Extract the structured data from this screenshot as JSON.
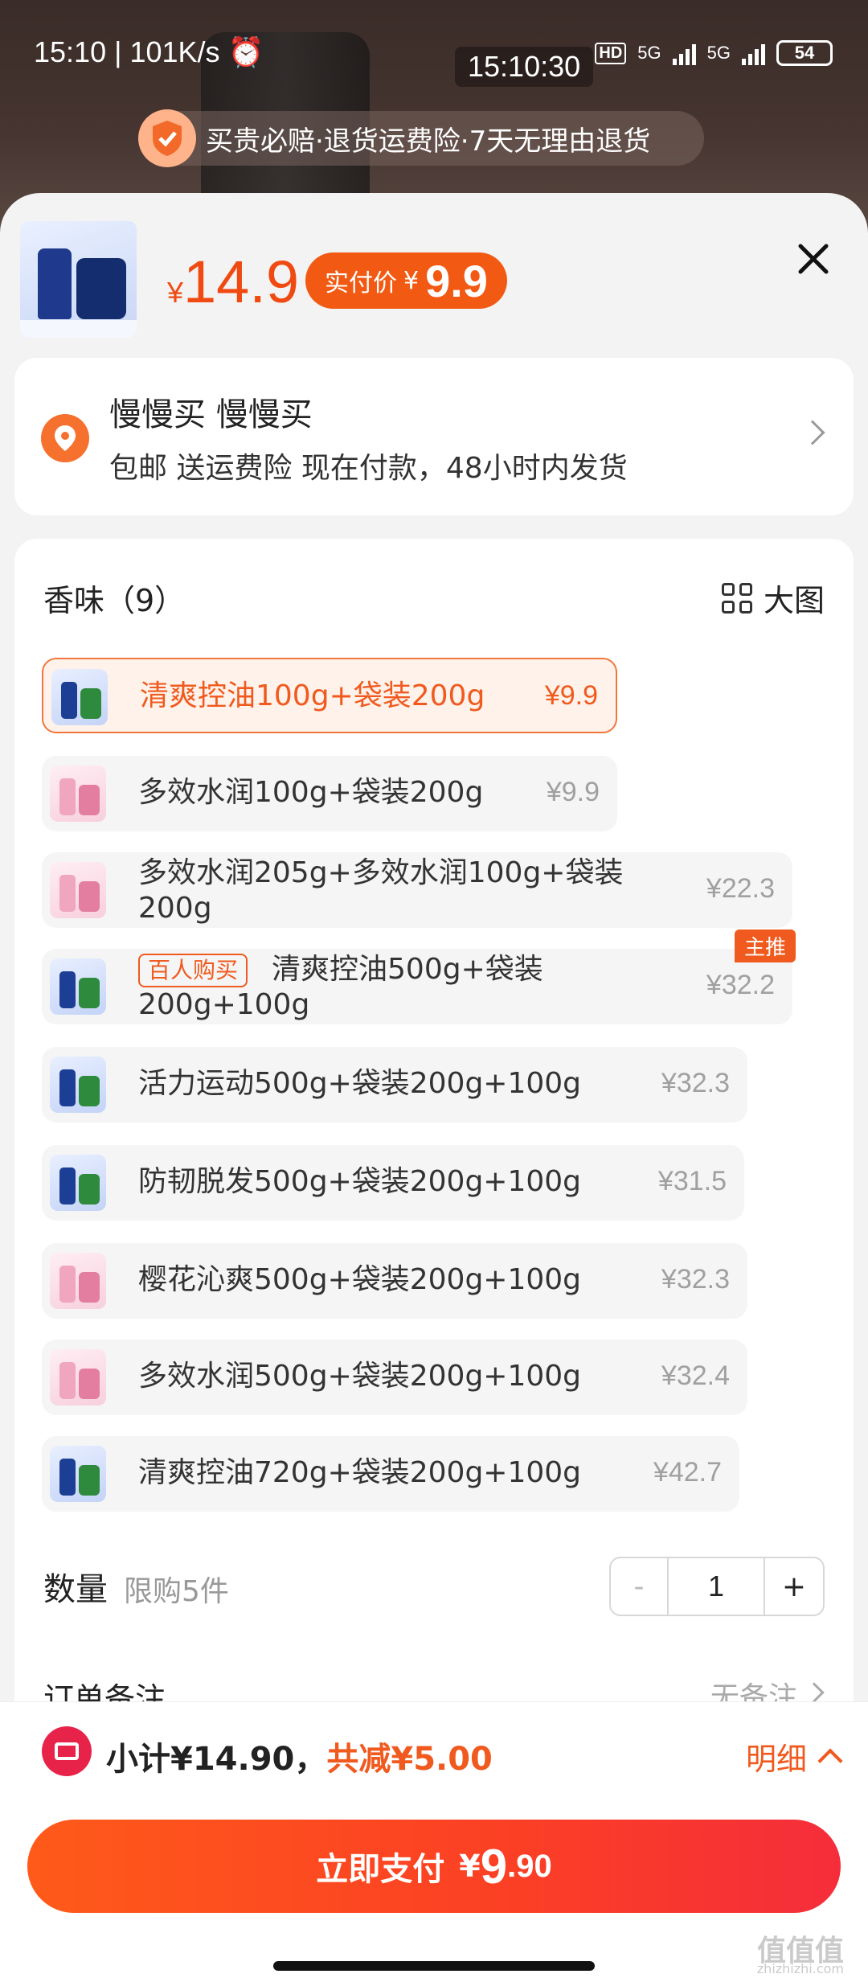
{
  "status_bar": {
    "time": "15:10",
    "speed": "101K/s",
    "center_time": "15:10:30",
    "network1": "5G",
    "network2": "5G",
    "battery": "54"
  },
  "guarantee_banner": "买贵必赔·退货运费险·7天无理由退货",
  "product_header": {
    "yen": "¥",
    "price": "14.9",
    "paid_label": "实付价",
    "paid_yen": "¥",
    "paid_price": "9.9"
  },
  "address": {
    "name": "慢慢买 慢慢买",
    "line": "包邮 送运费险 现在付款，48小时内发货"
  },
  "options": {
    "title": "香味（9）",
    "big_image": "大图",
    "items": [
      {
        "name": "清爽控油100g+袋装200g",
        "price": "¥9.9",
        "thumb": "blue",
        "selected": true
      },
      {
        "name": "多效水润100g+袋装200g",
        "price": "¥9.9",
        "thumb": "pink"
      },
      {
        "name": "多效水润205g+多效水润100g+袋装200g",
        "price": "¥22.3",
        "thumb": "pink"
      },
      {
        "name": "清爽控油500g+袋装200g+100g",
        "price": "¥32.2",
        "thumb": "blue",
        "tag": "百人购买",
        "badge": "主推"
      },
      {
        "name": "活力运动500g+袋装200g+100g",
        "price": "¥32.3",
        "thumb": "blue"
      },
      {
        "name": "防韧脱发500g+袋装200g+100g",
        "price": "¥31.5",
        "thumb": "blue"
      },
      {
        "name": "樱花沁爽500g+袋装200g+100g",
        "price": "¥32.3",
        "thumb": "pink"
      },
      {
        "name": "多效水润500g+袋装200g+100g",
        "price": "¥32.4",
        "thumb": "pink"
      },
      {
        "name": "清爽控油720g+袋装200g+100g",
        "price": "¥42.7",
        "thumb": "blue"
      }
    ]
  },
  "quantity": {
    "label": "数量",
    "limit": "限购5件",
    "minus": "-",
    "value": "1",
    "plus": "+"
  },
  "remark": {
    "label": "订单备注",
    "value": "无备注"
  },
  "footer": {
    "subtotal": "小计¥14.90，",
    "discount": "共减¥5.00",
    "detail": "明细",
    "pay_label": "立即支付",
    "pay_yen": "¥",
    "pay_int": "9",
    "pay_dec": ".90"
  },
  "watermark": "值值值",
  "watermark_url": "zhizhizhi.com",
  "colors": {
    "accent": "#f05a1e",
    "pay_gradient_start": "#ff5a1a",
    "pay_gradient_end": "#f52d3b"
  }
}
